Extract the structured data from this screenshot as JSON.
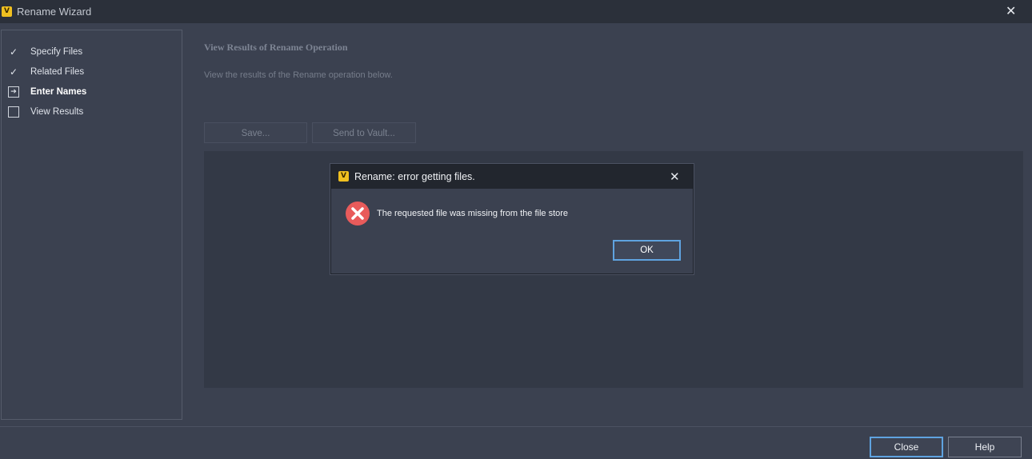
{
  "window": {
    "title": "Rename Wizard",
    "app_icon": "autodesk-vault-icon",
    "close_glyph": "✕"
  },
  "steps": [
    {
      "label": "Specify Files",
      "state": "completed",
      "mark": "✓"
    },
    {
      "label": "Related Files",
      "state": "completed",
      "mark": "✓"
    },
    {
      "label": "Enter Names",
      "state": "current",
      "mark": "➔"
    },
    {
      "label": "View Results",
      "state": "pending",
      "mark": ""
    }
  ],
  "main": {
    "section_title": "View Results of Rename Operation",
    "section_description": "View the results of the Rename operation below.",
    "save_label": "Save...",
    "send_to_vault_label": "Send to Vault..."
  },
  "dialog": {
    "title": "Rename: error getting files.",
    "message": "The requested file was missing from the file store",
    "ok_label": "OK",
    "close_glyph": "✕",
    "icon": "error-icon"
  },
  "footer": {
    "close_label": "Close",
    "help_label": "Help"
  },
  "colors": {
    "background": "#3b4150",
    "titlebar": "#2b303a",
    "accent_focus": "#5fa3e0",
    "error_red": "#e85b5b"
  }
}
